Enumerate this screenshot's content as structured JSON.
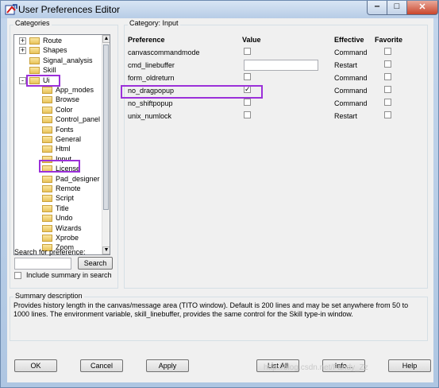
{
  "window": {
    "title": "User Preferences Editor"
  },
  "categories": {
    "label": "Categories",
    "tree": [
      {
        "label": "Route",
        "expander": "+"
      },
      {
        "label": "Shapes",
        "expander": "+"
      },
      {
        "label": "Signal_analysis",
        "expander": ""
      },
      {
        "label": "Skill",
        "expander": ""
      },
      {
        "label": "Ui",
        "expander": "-"
      },
      {
        "label": "App_modes"
      },
      {
        "label": "Browse"
      },
      {
        "label": "Color"
      },
      {
        "label": "Control_panel"
      },
      {
        "label": "Fonts"
      },
      {
        "label": "General"
      },
      {
        "label": "Html"
      },
      {
        "label": "Input"
      },
      {
        "label": "License"
      },
      {
        "label": "Pad_designer"
      },
      {
        "label": "Remote"
      },
      {
        "label": "Script"
      },
      {
        "label": "Title"
      },
      {
        "label": "Undo"
      },
      {
        "label": "Wizards"
      },
      {
        "label": "Xprobe"
      },
      {
        "label": "Zoom"
      }
    ],
    "search_label": "Search for preference:",
    "search_value": "",
    "search_button": "Search",
    "include_summary": "Include summary in search"
  },
  "category": {
    "label": "Category:  Input",
    "headers": {
      "preference": "Preference",
      "value": "Value",
      "effective": "Effective",
      "favorite": "Favorite"
    },
    "rows": [
      {
        "name": "canvascommandmode",
        "type": "check",
        "checked": false,
        "effective": "Command"
      },
      {
        "name": "cmd_linebuffer",
        "type": "text",
        "value": "",
        "effective": "Restart"
      },
      {
        "name": "form_oldreturn",
        "type": "check",
        "checked": false,
        "effective": "Command"
      },
      {
        "name": "no_dragpopup",
        "type": "check",
        "checked": true,
        "effective": "Command"
      },
      {
        "name": "no_shiftpopup",
        "type": "check",
        "checked": false,
        "effective": "Command"
      },
      {
        "name": "unix_numlock",
        "type": "check",
        "checked": false,
        "effective": "Restart"
      }
    ]
  },
  "summary": {
    "label": "Summary description",
    "text": "Provides history length in the canvas/message area (TITO window). Default is 200 lines and may be set anywhere from 50 to 1000 lines. The environment variable, skill_linebuffer, provides the same control for the Skill type-in window."
  },
  "buttons": {
    "ok": "OK",
    "cancel": "Cancel",
    "apply": "Apply",
    "list_all": "List All",
    "info": "Info...",
    "help": "Help"
  },
  "watermark": "http://blog.csdn.net/Fandy_Zz"
}
